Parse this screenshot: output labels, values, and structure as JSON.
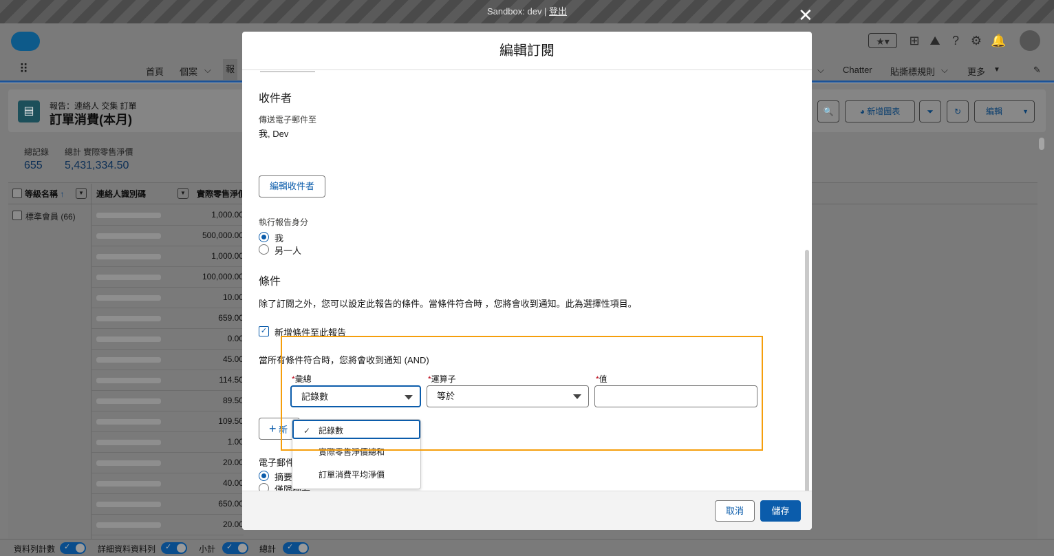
{
  "sandbox": {
    "text": "Sandbox: dev | ",
    "logout": "登出"
  },
  "nav": {
    "home": "首頁",
    "cases": "個案",
    "reports_partial": "報",
    "chatter": "Chatter",
    "sticker_rules": "貼撕標規則",
    "more": "更多"
  },
  "report": {
    "subtitle": "報告：連絡人 交集 訂單",
    "title": "訂單消費(本月)",
    "buttons": {
      "new_chart": "新增圖表",
      "edit": "編輯"
    },
    "stats": {
      "total_records_label": "總記錄",
      "total_records": "655",
      "total_sum_label": "總計 實際零售淨價",
      "total_sum": "5,431,334.50"
    },
    "columns": [
      "等級名稱",
      "連絡人識別碼",
      "實際零售淨價"
    ],
    "group": "標準會員 (66)",
    "amounts": [
      "1,000.00",
      "500,000.00",
      "1,000.00",
      "100,000.00",
      "10.00",
      "659.00",
      "0.00",
      "45.00",
      "114.50",
      "89.50",
      "109.50",
      "1.00",
      "20.00",
      "40.00",
      "650.00",
      "20.00"
    ]
  },
  "footer": {
    "row_count": "資料列計數",
    "detail_rows": "詳細資料資料列",
    "subtotal": "小計",
    "total": "總計"
  },
  "modal": {
    "title": "編輯訂閱",
    "recipients": {
      "heading": "收件者",
      "send_to_label": "傳送電子郵件至",
      "send_to_value": "我, Dev",
      "edit_button": "編輯收件者"
    },
    "run_as": {
      "label": "執行報告身分",
      "options": [
        "我",
        "另一人"
      ],
      "selected": "我"
    },
    "conditions": {
      "heading": "條件",
      "description": "除了訂閱之外，您可以設定此報告的條件。當條件符合時 ，您將會收到通知。此為選擇性項目。",
      "add_checkbox": "新增條件至此報告",
      "all_met": "當所有條件符合時，您將會收到通知 (AND)",
      "aggregate_label": "彙總",
      "aggregate_value": "記錄數",
      "operator_label": "運算子",
      "operator_value": "等於",
      "value_label": "值",
      "value_value": "",
      "add_partial": "新",
      "dropdown_options": [
        "記錄數",
        "實際零售淨價總和",
        "訂單消費平均淨價"
      ]
    },
    "email": {
      "label_partial": "電子郵件",
      "options_partial": [
        "摘要",
        "僅限摘要"
      ]
    },
    "cancel": "取消",
    "save": "儲存"
  }
}
